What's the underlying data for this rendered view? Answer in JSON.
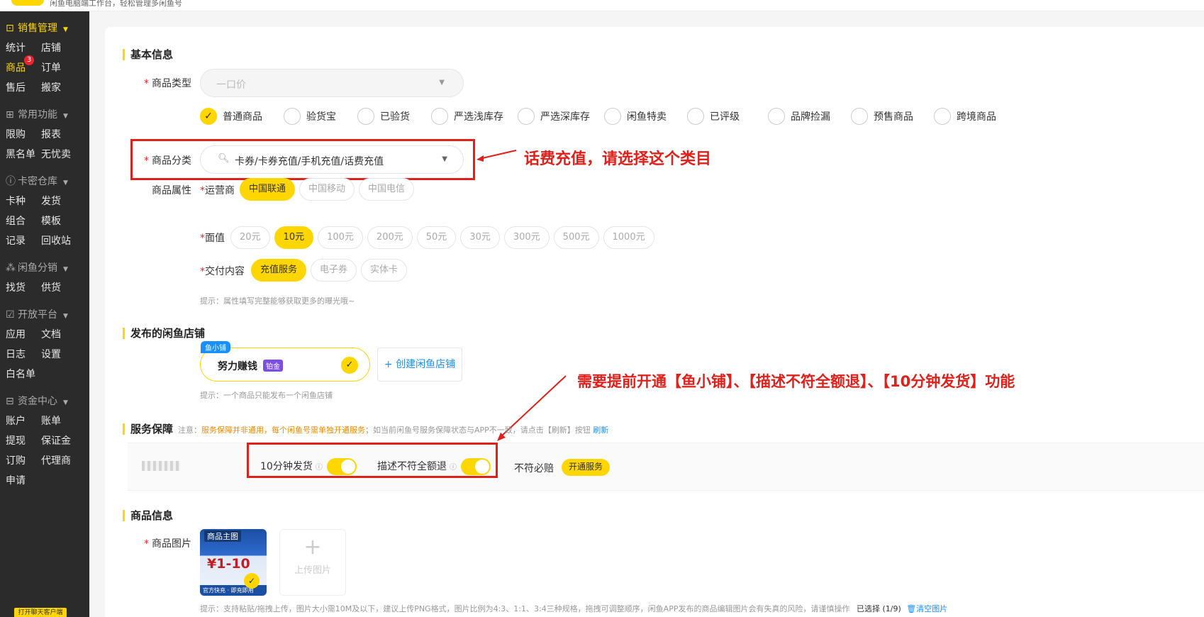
{
  "top": {
    "tip": "闲鱼电脑端工作台，轻松管理多闲鱼号"
  },
  "sidebar": {
    "sections": [
      {
        "title": "销售管理",
        "icon": "shop-icon",
        "items": [
          "统计",
          "店铺",
          "商品",
          "订单",
          "售后",
          "搬家"
        ]
      },
      {
        "title": "常用功能",
        "icon": "grid-icon",
        "items": [
          "限购",
          "报表",
          "黑名单",
          "无忧卖"
        ]
      },
      {
        "title": "卡密仓库",
        "icon": "warehouse-icon",
        "items": [
          "卡种",
          "发货",
          "组合",
          "模板",
          "记录",
          "回收站"
        ]
      },
      {
        "title": "闲鱼分销",
        "icon": "network-icon",
        "items": [
          "找货",
          "供货"
        ]
      },
      {
        "title": "开放平台",
        "icon": "open-icon",
        "items": [
          "应用",
          "文档",
          "日志",
          "设置",
          "白名单"
        ]
      },
      {
        "title": "资金中心",
        "icon": "wallet-icon",
        "items": [
          "账户",
          "账单",
          "提现",
          "保证金",
          "订购",
          "代理商",
          "申请"
        ]
      }
    ],
    "product_badge": "3",
    "bottom_button": "打开聊天客户端"
  },
  "basic": {
    "title": "基本信息",
    "type_label": "商品类型",
    "type_value": "一口价",
    "radios": [
      "普通商品",
      "验货宝",
      "已验货",
      "严选浅库存",
      "严选深库存",
      "闲鱼特卖",
      "已评级",
      "品牌捡漏",
      "预售商品",
      "跨境商品"
    ],
    "category_label": "商品分类",
    "category_value": "卡券/卡券充值/手机充值/话费充值",
    "category_annotation": "话费充值，请选择这个类目",
    "attr_label": "商品属性",
    "operator_label": "运营商",
    "operators": [
      "中国联通",
      "中国移动",
      "中国电信"
    ],
    "value_label": "面值",
    "values": [
      "20元",
      "10元",
      "100元",
      "200元",
      "50元",
      "30元",
      "300元",
      "500元",
      "1000元"
    ],
    "delivery_label": "交付内容",
    "deliveries": [
      "充值服务",
      "电子券",
      "实体卡"
    ],
    "attr_hint": "提示：属性填写完整能够获取更多的曝光哦~"
  },
  "shop": {
    "title": "发布的闲鱼店铺",
    "badge": "鱼小铺",
    "name": "努力赚钱",
    "level": "铂金",
    "create": "+ 创建闲鱼店铺",
    "hint": "提示：一个商品只能发布一个闲鱼店铺",
    "annotation": "需要提前开通【鱼小铺】、【描述不符全额退】、【10分钟发货】功能"
  },
  "service": {
    "title": "服务保障",
    "note_prefix": "注意：",
    "note_orange": "服务保障并非通用，每个闲鱼号需单独开通服务",
    "note_rest": "；如当前闲鱼号服务保障状态与APP不一致，请点击【刷新】按钮",
    "refresh": "刷新",
    "svc1": "10分钟发货",
    "svc2": "描述不符全额退",
    "svc3": "不符必赔",
    "open_btn": "开通服务"
  },
  "product": {
    "title": "商品信息",
    "img_label": "商品图片",
    "main_img_tag": "商品主图",
    "img_text": "¥1-10",
    "img_footer": "官方快充 · 即充即用",
    "upload": "上传图片",
    "hint": "提示：支持粘贴/拖拽上传，图片大小需10M及以下，建议上传PNG格式，图片比例为4:3、1:1、3:4三种规格，拖拽可调整顺序，闲鱼APP发布的商品编辑图片会有失真的风险，请谨慎操作",
    "selected": "已选择",
    "count": "(1/9)",
    "clear": "清空图片"
  }
}
